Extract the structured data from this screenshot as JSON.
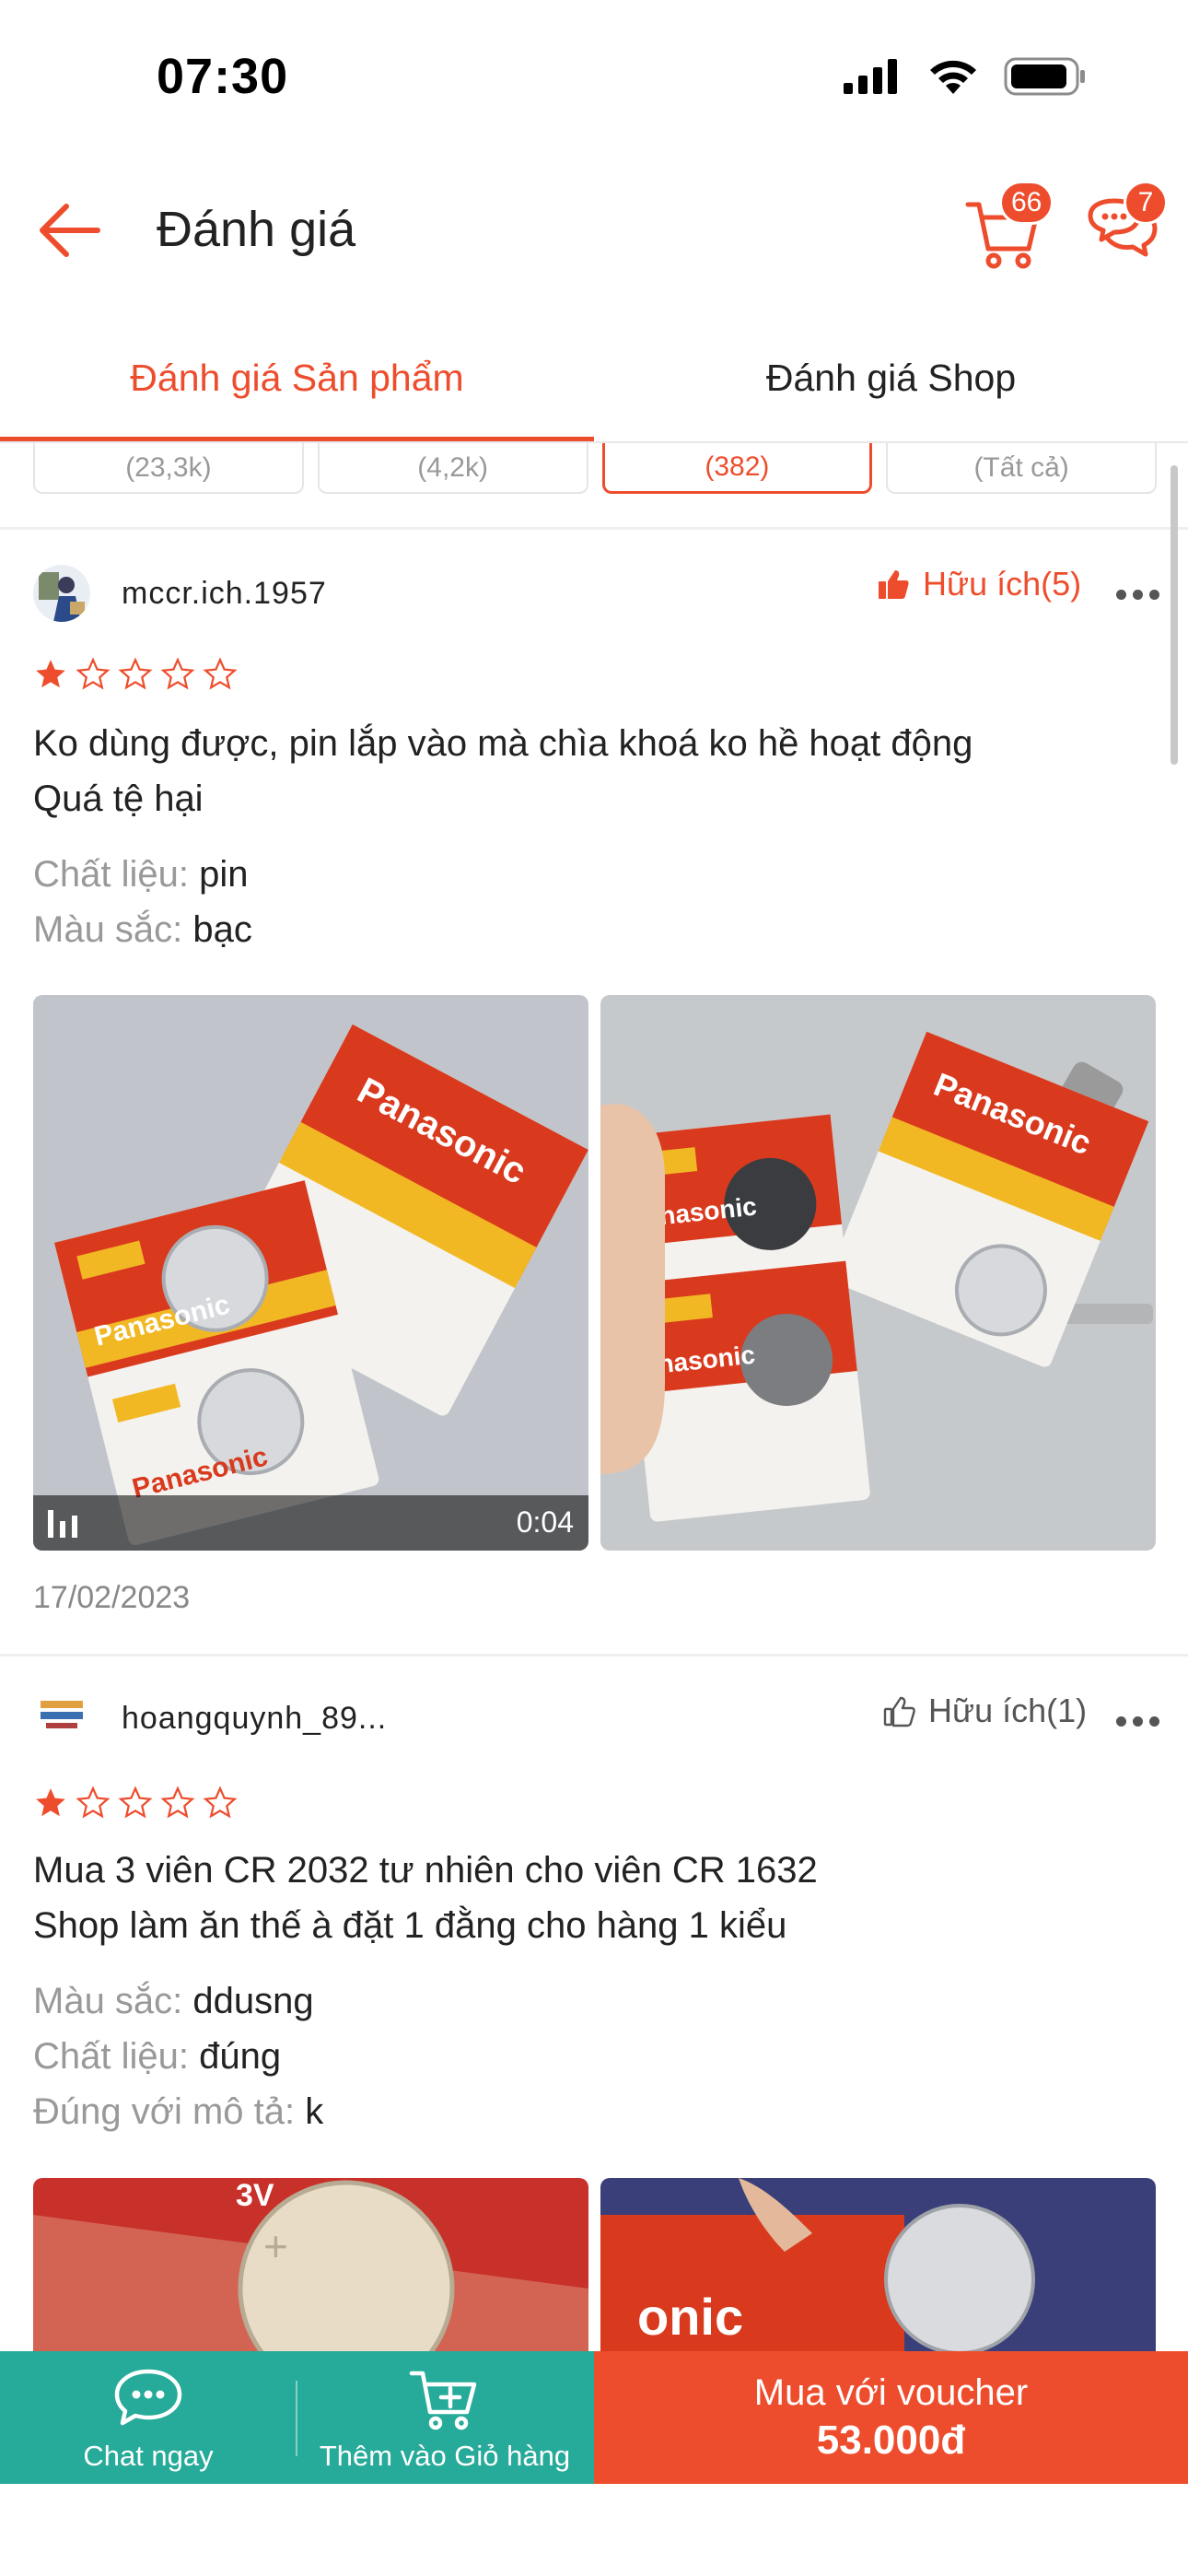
{
  "status_bar": {
    "time": "07:30"
  },
  "header": {
    "title": "Đánh giá",
    "cart_count": "66",
    "chat_count": "7"
  },
  "tabs": [
    {
      "label": "Đánh giá Sản phẩm",
      "active": true
    },
    {
      "label": "Đánh giá Shop",
      "active": false
    }
  ],
  "filters": [
    {
      "label": "(23,3k)"
    },
    {
      "label": "(4,2k)"
    },
    {
      "label": "(382)",
      "active": true
    },
    {
      "label": "(Tất cả)"
    }
  ],
  "reviews": [
    {
      "username": "mccr.ich.1957",
      "helpful_label": "Hữu ích(5)",
      "helpful_active": true,
      "rating": 1,
      "text_line1": "Ko dùng được, pin lắp vào mà chìa khoá ko hề hoạt động",
      "text_line2": "Quá tệ hại",
      "attributes": [
        {
          "key": "Chất liệu: ",
          "value": "pin"
        },
        {
          "key": "Màu sắc: ",
          "value": "bạc"
        }
      ],
      "video_duration": "0:04",
      "date": "17/02/2023"
    },
    {
      "username": "hoangquynh_89...",
      "helpful_label": "Hữu ích(1)",
      "helpful_active": false,
      "rating": 1,
      "text_line1": "Mua 3 viên CR 2032 tư nhiên cho viên CR 1632",
      "text_line2": "Shop làm ăn thế à đặt 1 đằng cho hàng 1 kiểu",
      "attributes": [
        {
          "key": "Màu sắc: ",
          "value": "ddusng"
        },
        {
          "key": "Chất liệu: ",
          "value": "đúng"
        },
        {
          "key": "Đúng với mô tả: ",
          "value": "k"
        }
      ]
    }
  ],
  "bottom_bar": {
    "chat_label": "Chat ngay",
    "cart_label": "Thêm vào Giỏ hàng",
    "buy_label": "Mua với voucher",
    "buy_price": "53.000đ"
  },
  "colors": {
    "accent": "#ee4d2d",
    "teal": "#26aa99",
    "star": "#ee4d2d"
  }
}
